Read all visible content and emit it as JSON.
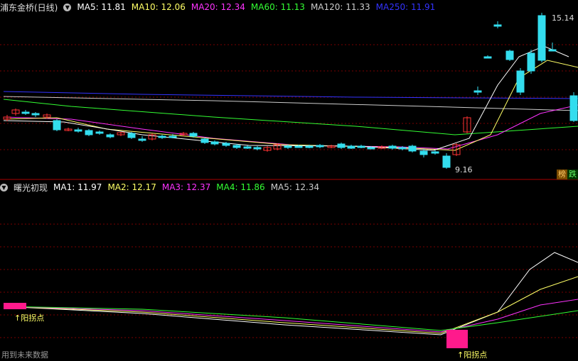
{
  "top_panel": {
    "title": "浦东金桥(日线)",
    "ma_labels": [
      {
        "label": "MA5: 11.81",
        "color": "#ffffff"
      },
      {
        "label": "MA10: 12.06",
        "color": "#ffff66"
      },
      {
        "label": "MA20: 12.34",
        "color": "#ff33ff"
      },
      {
        "label": "MA60: 11.13",
        "color": "#33ff33"
      },
      {
        "label": "MA120: 11.33",
        "color": "#cccccc"
      },
      {
        "label": "MA250: 11.91",
        "color": "#3333ff"
      }
    ],
    "high_label": "15.14",
    "low_label": "9.16",
    "side_tags": [
      {
        "text": "榜",
        "bg": "#7a4a00",
        "color": "#ffcc66"
      },
      {
        "text": "跌",
        "bg": "#003300",
        "color": "#66ff66"
      }
    ]
  },
  "bottom_panel": {
    "title": "曙光初现",
    "ma_labels": [
      {
        "label": "MA1: 11.97",
        "color": "#ffffff"
      },
      {
        "label": "MA2: 12.17",
        "color": "#ffff66"
      },
      {
        "label": "MA3: 12.37",
        "color": "#ff33ff"
      },
      {
        "label": "MA4: 11.86",
        "color": "#33ff33"
      },
      {
        "label": "MA5: 12.34",
        "color": "#cccccc"
      }
    ],
    "signal_label_1": "↑阳拐点",
    "signal_label_2": "↑阳拐点",
    "footer_note": "用到未来数据"
  },
  "colors": {
    "up": "#ff3333",
    "down": "#33ddee",
    "grid": "#7a0000",
    "signal": "#ff1a8c"
  }
}
